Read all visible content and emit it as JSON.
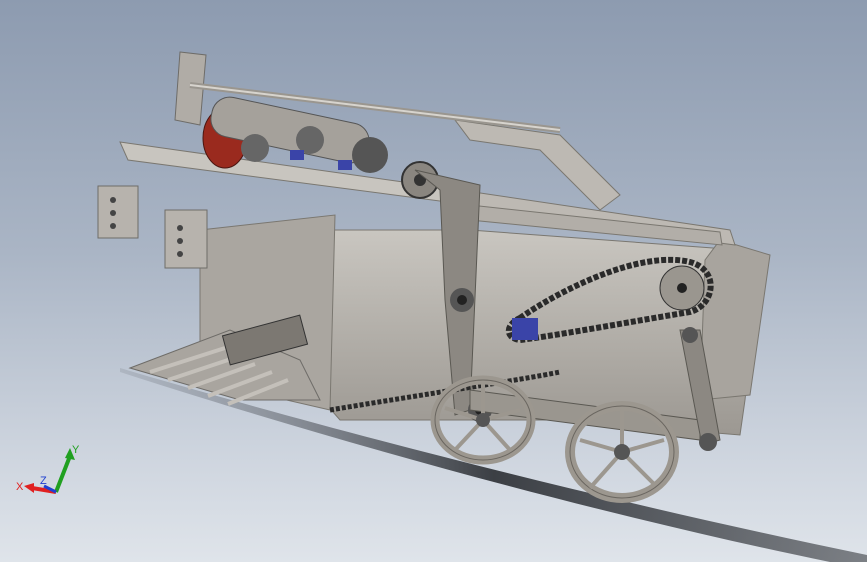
{
  "triad": {
    "x_label": "X",
    "y_label": "Y",
    "z_label": "Z",
    "x_color": "#e02020",
    "y_color": "#20a020",
    "z_color": "#2040d0"
  },
  "colors": {
    "background_top": "#8d9bb0",
    "background_bottom": "#dfe4ea",
    "metal": "#b9b5ae",
    "metal_dark": "#6e6c68",
    "chain": "#2a2a2a",
    "belt_red": "#9a2a1e",
    "bearing_blue": "#3a44a8"
  }
}
